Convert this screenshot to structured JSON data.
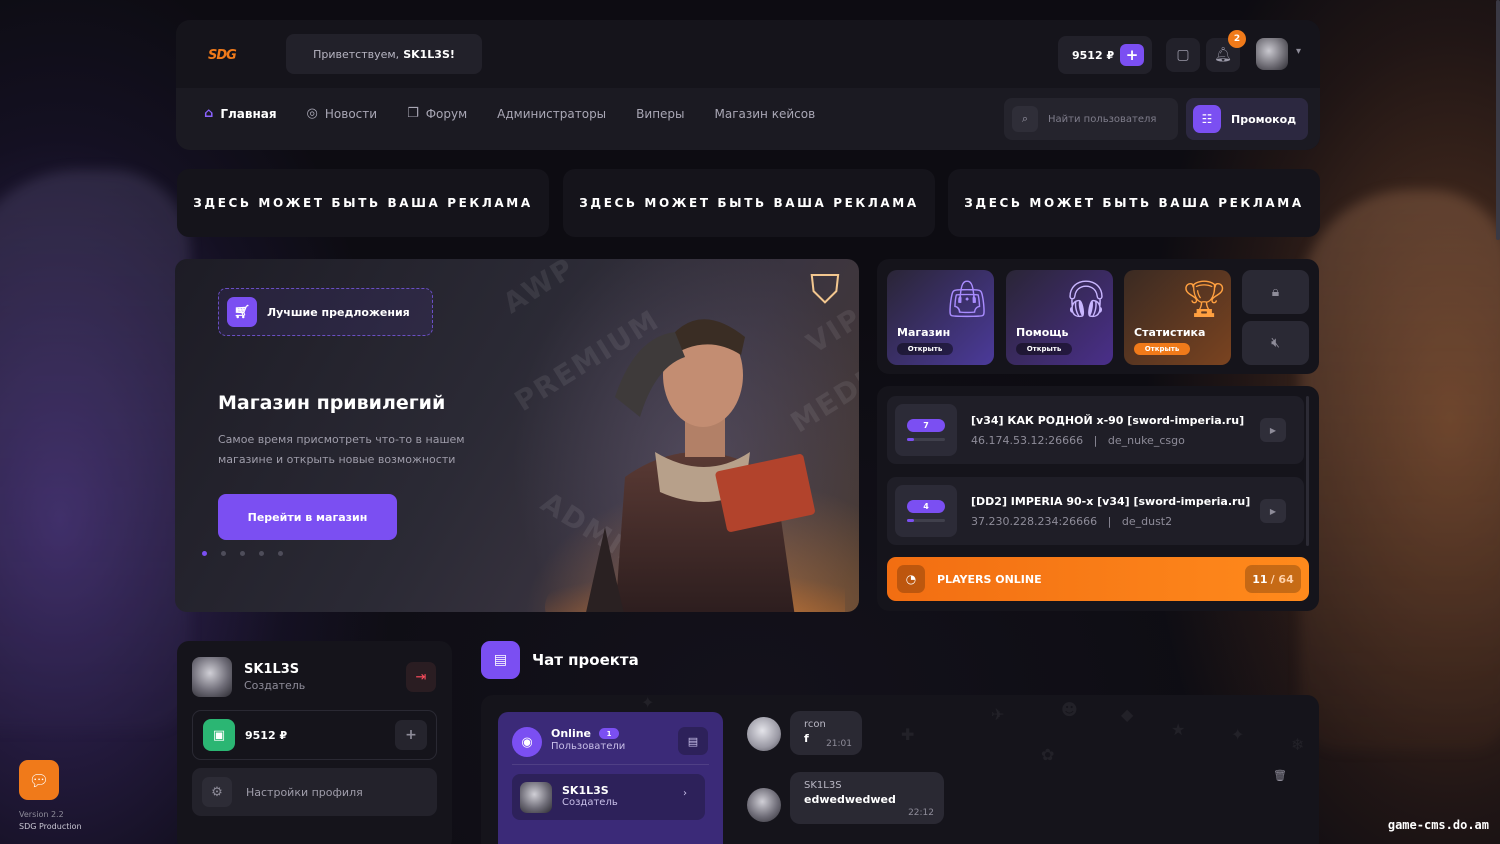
{
  "header": {
    "logo_text": "SDG",
    "greeting_prefix": "Приветствуем,",
    "greeting_user": "SK1L3S!",
    "balance": "9512 ₽",
    "notifications_count": "2",
    "icons": [
      "chat-icon",
      "bell-icon",
      "chevron-down-icon",
      "plus-icon"
    ]
  },
  "nav": {
    "items": [
      {
        "label": "Главная",
        "icon": "home-icon",
        "active": true
      },
      {
        "label": "Новости",
        "icon": "globe-icon",
        "active": false
      },
      {
        "label": "Форум",
        "icon": "forum-icon",
        "active": false
      },
      {
        "label": "Администраторы",
        "active": false
      },
      {
        "label": "Виперы",
        "active": false
      },
      {
        "label": "Магазин кейсов",
        "active": false
      }
    ],
    "search_placeholder": "Найти пользователя",
    "promo_label": "Промокод"
  },
  "ads": [
    "ЗДЕСЬ МОЖЕТ БЫТЬ ВАША РЕКЛАМА",
    "ЗДЕСЬ МОЖЕТ БЫТЬ ВАША РЕКЛАМА",
    "ЗДЕСЬ МОЖЕТ БЫТЬ ВАША РЕКЛАМА"
  ],
  "hero": {
    "badge": "Лучшие предложения",
    "title": "Магазин привилегий",
    "description": "Самое время присмотреть что-то в нашем магазине и открыть новые возможности",
    "button": "Перейти в магазин",
    "slides_total": 5,
    "slide_active": 1,
    "watermarks": [
      "AWP",
      "PREMIUM",
      "VIP",
      "MEDIA",
      "ADMIN"
    ]
  },
  "tiles": [
    {
      "title": "Магазин",
      "action": "Открыть",
      "color": "#7b4ff2"
    },
    {
      "title": "Помощь",
      "action": "Открыть",
      "color": "#6a3fd8"
    },
    {
      "title": "Статистика",
      "action": "Открыть",
      "color": "#f07a1a"
    }
  ],
  "servers": [
    {
      "players": "7",
      "name": "[v34] КАК РОДНОЙ x-90 [sword-imperia.ru]",
      "ip": "46.174.53.12:26666",
      "map": "de_nuke_csgo",
      "fill": 0.18
    },
    {
      "players": "4",
      "name": "[DD2] IMPERIA 90-x [v34] [sword-imperia.ru]",
      "ip": "37.230.228.234:26666",
      "map": "de_dust2",
      "fill": 0.18
    }
  ],
  "players_online": {
    "label": "PLAYERS ONLINE",
    "current": "11",
    "max": "/ 64"
  },
  "profile": {
    "name": "SK1L3S",
    "role": "Создатель",
    "balance": "9512 ₽",
    "settings": "Настройки профиля"
  },
  "chat": {
    "title": "Чат проекта",
    "online": {
      "title": "Online",
      "count": "1",
      "subtitle": "Пользователи",
      "user_name": "SK1L3S",
      "user_role": "Создатель"
    },
    "messages": [
      {
        "author": "rcon",
        "text": "f",
        "time": "21:01"
      },
      {
        "author": "SK1L3S",
        "text": "edwedwedwed",
        "time": "22:12"
      }
    ]
  },
  "footer": {
    "version": "Version 2.2",
    "production": "SDG Production",
    "watermark": "game-cms.do.am"
  },
  "colors": {
    "accent": "#7b4ff2",
    "orange": "#f07a1a",
    "bg": "#0d0c12",
    "panel": "#15141b",
    "danger": "#ff4d5e",
    "success": "#2bb673"
  }
}
